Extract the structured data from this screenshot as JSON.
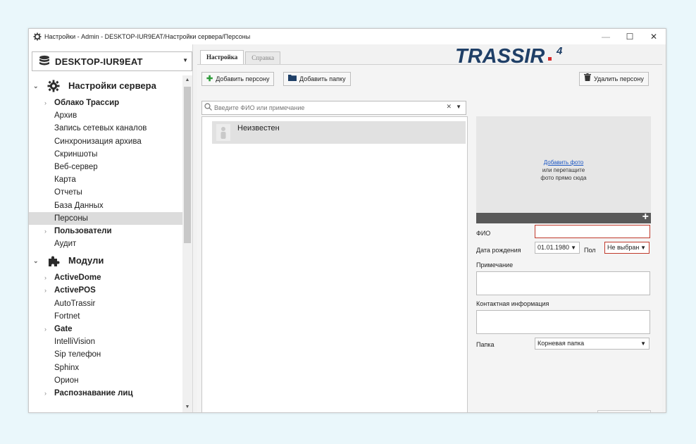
{
  "window": {
    "title": "Настройки - Admin - DESKTOP-IUR9EAT/Настройки сервера/Персоны",
    "controls": {
      "minimize": "—",
      "maximize": "☐",
      "close": "✕"
    }
  },
  "server": {
    "name": "DESKTOP-IUR9EAT"
  },
  "tree": {
    "sections": [
      {
        "label": "Настройки сервера",
        "icon": "gear-icon",
        "items": [
          {
            "label": "Облако Трассир",
            "bold": true,
            "expandable": true
          },
          {
            "label": "Архив"
          },
          {
            "label": "Запись сетевых каналов"
          },
          {
            "label": "Синхронизация архива"
          },
          {
            "label": "Скриншоты"
          },
          {
            "label": "Веб-сервер"
          },
          {
            "label": "Карта"
          },
          {
            "label": "Отчеты"
          },
          {
            "label": "База Данных"
          },
          {
            "label": "Персоны",
            "selected": true
          },
          {
            "label": "Пользователи",
            "bold": true,
            "expandable": true
          },
          {
            "label": "Аудит"
          }
        ]
      },
      {
        "label": "Модули",
        "icon": "puzzle-icon",
        "items": [
          {
            "label": "ActiveDome",
            "bold": true,
            "expandable": true
          },
          {
            "label": "ActivePOS",
            "bold": true,
            "expandable": true
          },
          {
            "label": "AutoTrassir"
          },
          {
            "label": "Fortnet"
          },
          {
            "label": "Gate",
            "bold": true,
            "expandable": true
          },
          {
            "label": "IntelliVision"
          },
          {
            "label": "Sip телефон"
          },
          {
            "label": "Sphinx"
          },
          {
            "label": "Орион"
          },
          {
            "label": "Распознавание лиц",
            "bold": true,
            "expandable": true
          }
        ]
      }
    ]
  },
  "tabs": [
    {
      "label": "Настройка",
      "active": true
    },
    {
      "label": "Справка",
      "active": false
    }
  ],
  "logo": {
    "text": "TRASSIR",
    "version": "4"
  },
  "toolbar": {
    "add_person": "Добавить персону",
    "add_folder": "Добавить папку",
    "delete_person": "Удалить персону"
  },
  "search": {
    "placeholder": "Введите ФИО или примечание",
    "clear": "✕"
  },
  "persons": [
    {
      "name": "Неизвестен"
    }
  ],
  "photo": {
    "add_link": "Добавить фото",
    "hint_line1": "или перетащите",
    "hint_line2": "фото прямо сюда",
    "add_button": "+"
  },
  "form": {
    "fio_label": "ФИО",
    "fio_value": "",
    "birth_label": "Дата рождения",
    "birth_value": "01.01.1980",
    "gender_label": "Пол",
    "gender_value": "Не выбран",
    "note_label": "Примечание",
    "contact_label": "Контактная информация",
    "folder_label": "Папка",
    "folder_value": "Корневая папка"
  },
  "colors": {
    "accent_red": "#c0392b",
    "logo_blue": "#1f3f67",
    "logo_red": "#d72a2a",
    "selection": "#dcdcdc",
    "link": "#1a56c4"
  }
}
